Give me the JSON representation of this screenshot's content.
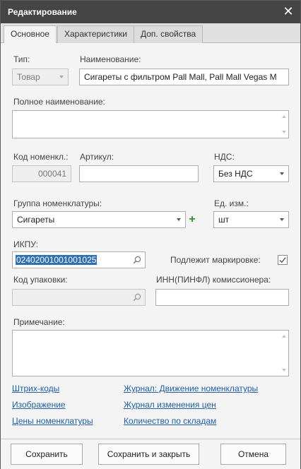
{
  "window": {
    "title": "Редактирование"
  },
  "tabs": [
    {
      "label": "Основное",
      "active": true
    },
    {
      "label": "Характеристики",
      "active": false
    },
    {
      "label": "Доп. свойства",
      "active": false
    }
  ],
  "form": {
    "type_label": "Тип:",
    "type_value": "Товар",
    "name_label": "Наименование:",
    "name_value": "Сигареты с фильтром Pall Mall, Pall Mall Vegas M",
    "full_name_label": "Полное наименование:",
    "full_name_value": "",
    "code_label": "Код номенкл.:",
    "code_value": "000041",
    "article_label": "Артикул:",
    "article_value": "",
    "vat_label": "НДС:",
    "vat_value": "Без НДС",
    "group_label": "Группа номенклатуры:",
    "group_value": "Сигареты",
    "unit_label": "Ед. изм.:",
    "unit_value": "шт",
    "ikpu_label": "ИКПУ:",
    "ikpu_value": "02402001001001025",
    "marking_label": "Подлежит маркировке:",
    "marking_checked": true,
    "marking_mark": "✓",
    "package_label": "Код упаковки:",
    "package_value": "",
    "inn_label": "ИНН(ПИНФЛ) комиссионера:",
    "inn_value": "",
    "note_label": "Примечание:",
    "note_value": ""
  },
  "links": {
    "barcodes": "Штрих-коды",
    "image": "Изображение",
    "prices": "Цены номенклатуры",
    "movement_journal": "Журнал: Движение номенклатуры",
    "price_journal": "Журнал изменения цен",
    "stock": "Количество по складам"
  },
  "buttons": {
    "save": "Сохранить",
    "save_close": "Сохранить и закрыть",
    "cancel": "Отмена"
  },
  "icons": {
    "close": "close-icon",
    "dropdown": "chevron-down-icon",
    "search": "search-icon",
    "add": "plus-icon",
    "check": "checkmark-icon"
  },
  "colors": {
    "titlebar": "#454545",
    "link": "#1f5fa8",
    "selection": "#2f6fb5",
    "add_green": "#2f8f2f"
  }
}
